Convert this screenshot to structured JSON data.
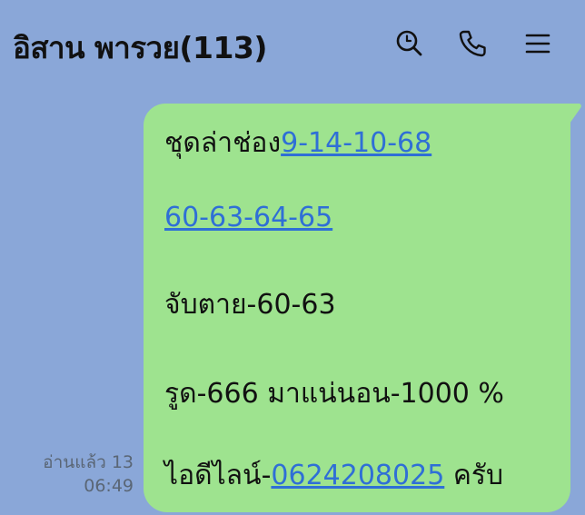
{
  "header": {
    "title": "อิสาน พารวย(113)",
    "icons": [
      "search-icon",
      "phone-icon",
      "menu-icon"
    ]
  },
  "message": {
    "line1_prefix": "ชุดล่าช่อง",
    "line1_link": "9-14-10-68",
    "line2_link": "60-63-64-65",
    "line3": "จับตาย-60-63",
    "line4": "รูด-666 มาแน่นอน-1000 %",
    "line5_prefix": "ไอดีไลน์-",
    "line5_link": "0624208025",
    "line5_suffix": " ครับ"
  },
  "meta": {
    "read_status": "อ่านแล้ว 13",
    "time": "06:49"
  },
  "colors": {
    "background": "#8aa7d8",
    "bubble": "#9ee38f",
    "link": "#2f6fd6"
  }
}
